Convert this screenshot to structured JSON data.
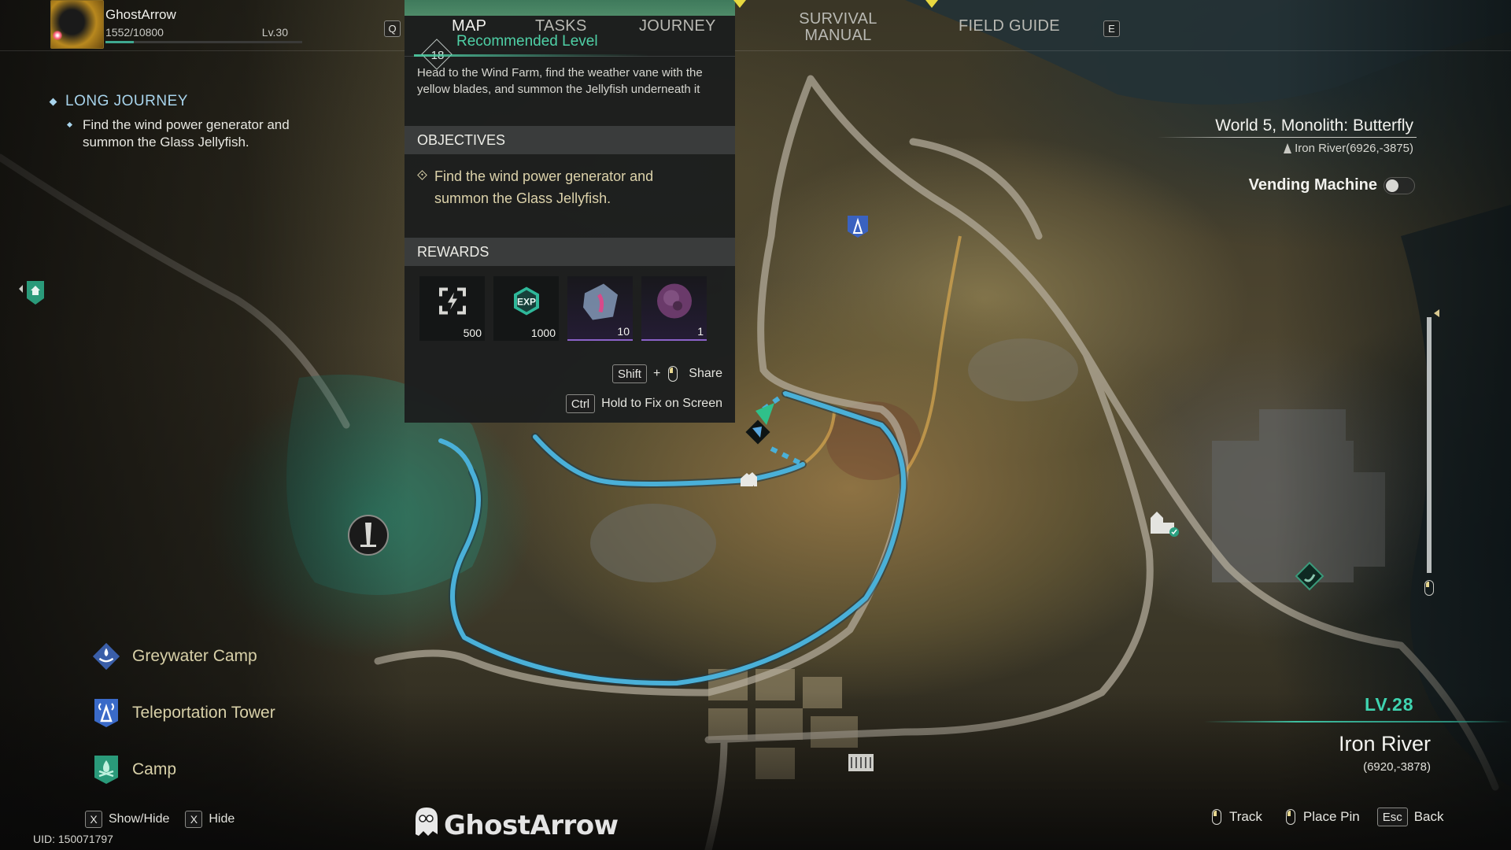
{
  "player": {
    "name": "GhostArrow",
    "xp": "1552/10800",
    "xp_fraction": 0.144,
    "level": "Lv.30"
  },
  "keys": {
    "prev_tab": "Q",
    "next_tab": "E"
  },
  "tabs": [
    {
      "label": "MAP",
      "active": true
    },
    {
      "label": "TASKS",
      "active": false
    },
    {
      "label": "JOURNEY",
      "active": false
    },
    {
      "label": "SURVIVAL MANUAL",
      "active": false
    },
    {
      "label": "FIELD GUIDE",
      "active": false
    }
  ],
  "quest": {
    "recommended_level": "18",
    "recommended_label": "Recommended Level",
    "description": "Head to the Wind Farm, find the weather vane with the yellow blades, and summon the Jellyfish underneath it",
    "objectives_header": "OBJECTIVES",
    "objective": "Find the wind power generator and summon the Glass Jellyfish.",
    "rewards_header": "REWARDS",
    "rewards": [
      {
        "icon": "energy-icon",
        "count": "500"
      },
      {
        "icon": "exp-icon",
        "count": "1000"
      },
      {
        "icon": "jellyfish-cube-icon",
        "count": "10"
      },
      {
        "icon": "purple-orb-icon",
        "count": "1"
      }
    ],
    "share_key": "Shift",
    "share_plus": "+",
    "share_label": "Share",
    "fix_key": "Ctrl",
    "fix_label": "Hold to Fix on Screen"
  },
  "tracker": {
    "title": "LONG JOURNEY",
    "step": "Find the wind power generator and summon the Glass Jellyfish."
  },
  "legend": [
    {
      "icon": "greywater-camp-icon",
      "label": "Greywater Camp",
      "color": "#3a5ea8"
    },
    {
      "icon": "teleportation-tower-icon",
      "label": "Teleportation Tower",
      "color": "#3a6ac8"
    },
    {
      "icon": "camp-icon",
      "label": "Camp",
      "color": "#2a9a7a"
    }
  ],
  "bottom_left": {
    "show_hide_key": "X",
    "show_hide_label": "Show/Hide",
    "hide_key": "X",
    "hide_label": "Hide",
    "uid": "UID: 150071797"
  },
  "watermark": "GhostArrow",
  "world": {
    "title": "World 5, Monolith: Butterfly",
    "location": "Iron River(6926,-3875)",
    "vending_label": "Vending Machine",
    "vending_on": false
  },
  "zoom_level_fraction": 1.0,
  "region": {
    "level": "LV.28",
    "name": "Iron River",
    "coords": "(6920,-3878)"
  },
  "bottom_right": {
    "track_label": "Track",
    "pin_label": "Place Pin",
    "back_key": "Esc",
    "back_label": "Back"
  },
  "colors": {
    "accent_teal": "#4fd0a6",
    "route_blue": "#3fa8d0",
    "tracker_blue": "#a8d4ec",
    "objective_gold": "#dcd2aa"
  }
}
